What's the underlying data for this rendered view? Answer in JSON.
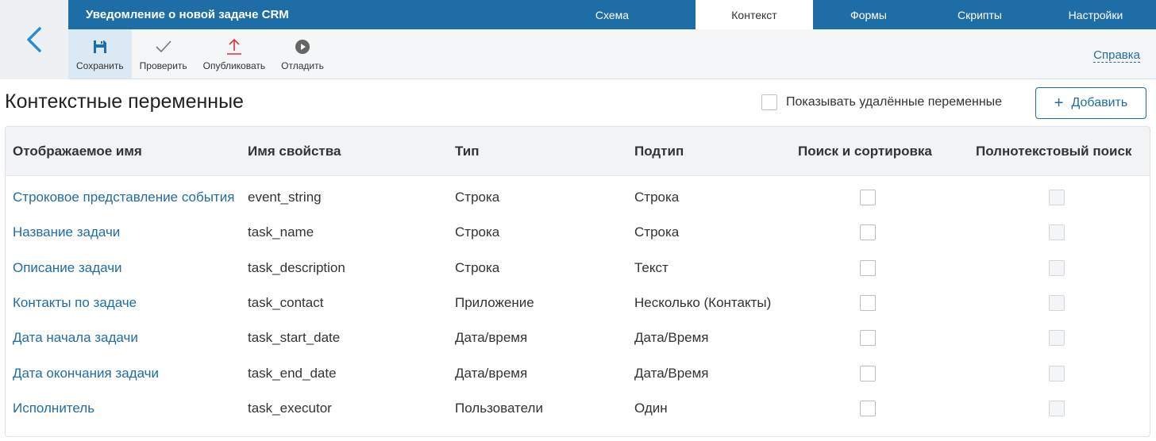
{
  "header": {
    "title": "Уведомление о новой задаче CRM",
    "tabs": [
      {
        "label": "Схема",
        "active": false
      },
      {
        "label": "Контекст",
        "active": true
      },
      {
        "label": "Формы",
        "active": false
      },
      {
        "label": "Скрипты",
        "active": false
      },
      {
        "label": "Настройки",
        "active": false
      }
    ],
    "accent_color": "#1f6da6"
  },
  "toolbar": {
    "items": [
      {
        "label": "Сохранить",
        "icon": "floppy-disk-icon"
      },
      {
        "label": "Проверить",
        "icon": "checkmark-icon"
      },
      {
        "label": "Опубликовать",
        "icon": "upload-arrow-icon"
      },
      {
        "label": "Отладить",
        "icon": "play-circle-icon"
      }
    ],
    "help_label": "Справка"
  },
  "page": {
    "title": "Контекстные переменные",
    "show_deleted_label": "Показывать удалённые переменные",
    "add_label": "Добавить"
  },
  "table": {
    "columns": [
      "Отображаемое имя",
      "Имя свойства",
      "Тип",
      "Подтип",
      "Поиск и сортировка",
      "Полнотекстовый поиск"
    ],
    "rows": [
      {
        "display": "Строковое представление события",
        "prop": "event_string",
        "type": "Строка",
        "subtype": "Строка"
      },
      {
        "display": "Название задачи",
        "prop": "task_name",
        "type": "Строка",
        "subtype": "Строка"
      },
      {
        "display": "Описание задачи",
        "prop": "task_description",
        "type": "Строка",
        "subtype": "Текст"
      },
      {
        "display": "Контакты по задаче",
        "prop": "task_contact",
        "type": "Приложение",
        "subtype": "Несколько (Контакты)"
      },
      {
        "display": "Дата начала задачи",
        "prop": "task_start_date",
        "type": "Дата/время",
        "subtype": "Дата/Время"
      },
      {
        "display": "Дата окончания задачи",
        "prop": "task_end_date",
        "type": "Дата/время",
        "subtype": "Дата/Время"
      },
      {
        "display": "Исполнитель",
        "prop": "task_executor",
        "type": "Пользователи",
        "subtype": "Один"
      }
    ]
  }
}
